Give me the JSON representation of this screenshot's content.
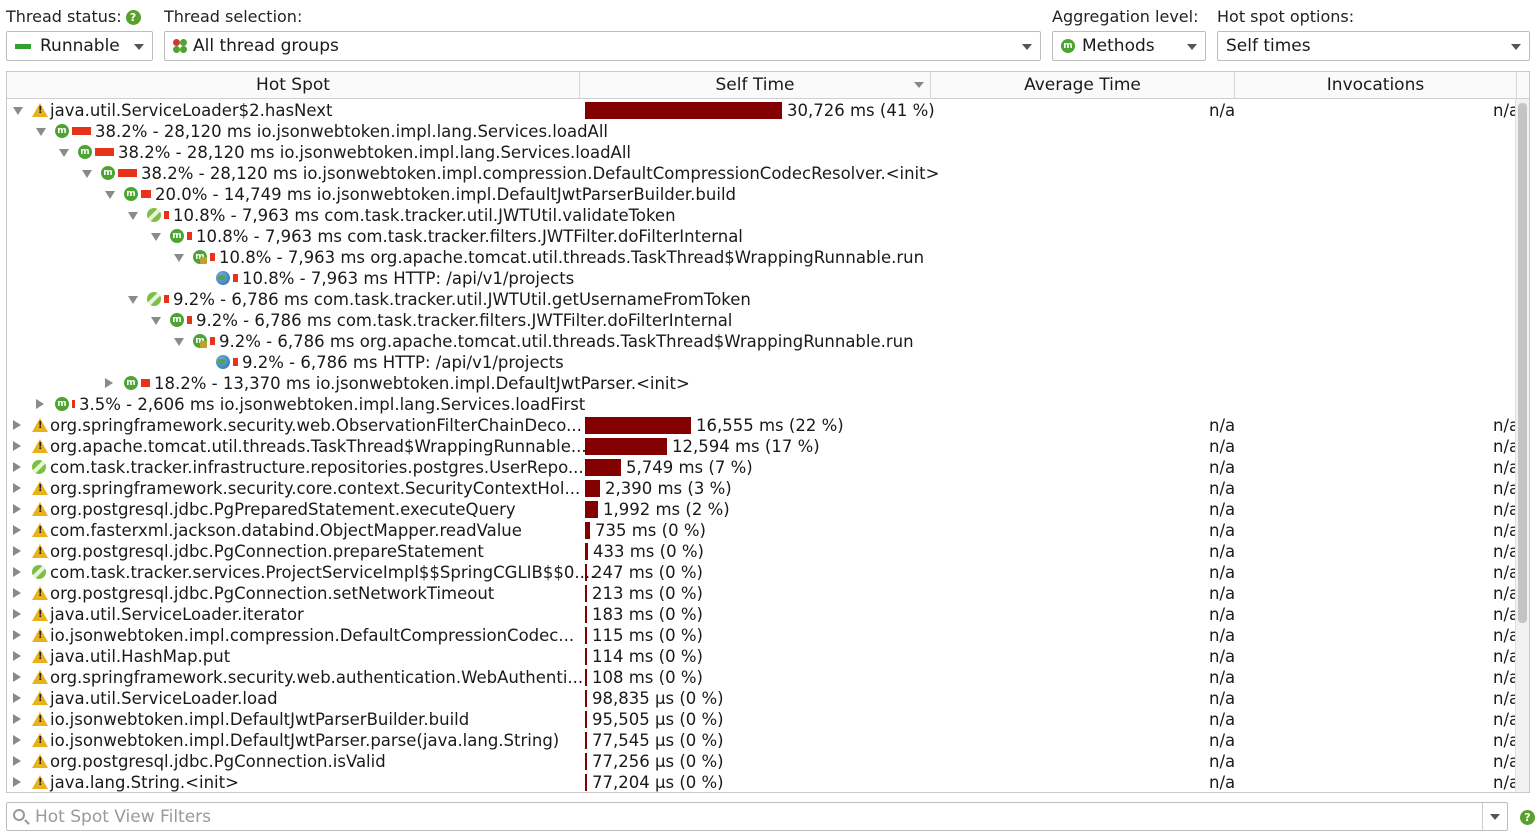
{
  "toolbar": {
    "thread_status_label": "Thread status:",
    "thread_status_value": "Runnable",
    "thread_selection_label": "Thread selection:",
    "thread_selection_value": "All thread groups",
    "aggregation_label": "Aggregation level:",
    "aggregation_value": "Methods",
    "hotspot_options_label": "Hot spot options:",
    "hotspot_options_value": "Self times",
    "help_glyph": "?",
    "method_glyph": "m"
  },
  "columns": {
    "hot_spot": "Hot Spot",
    "self_time": "Self Time",
    "average_time": "Average Time",
    "invocations": "Invocations"
  },
  "colors": {
    "self_time_bar": "#820000",
    "percent_bar": "#e8331c",
    "method_icon": "#4ea432",
    "warning_icon": "#e9b21a"
  },
  "rows": [
    {
      "depth": 0,
      "toggle": "open",
      "icon": "warning-icon",
      "text": "java.util.ServiceLoader$2.hasNext",
      "self_time": "30,726 ms (41 %)",
      "fraction": 0.41,
      "avg": "n/a",
      "inv": "n/a"
    },
    {
      "depth": 1,
      "toggle": "open",
      "icon": "method-icon",
      "pct": 0.382,
      "text": "38.2% - 28,120 ms io.jsonwebtoken.impl.lang.Services.loadAll"
    },
    {
      "depth": 2,
      "toggle": "open",
      "icon": "method-icon",
      "pct": 0.382,
      "text": "38.2% - 28,120 ms io.jsonwebtoken.impl.lang.Services.loadAll"
    },
    {
      "depth": 3,
      "toggle": "open",
      "icon": "method-icon",
      "pct": 0.382,
      "text": "38.2% - 28,120 ms io.jsonwebtoken.impl.compression.DefaultCompressionCodecResolver.<init>"
    },
    {
      "depth": 4,
      "toggle": "open",
      "icon": "method-icon",
      "pct": 0.2,
      "text": "20.0% - 14,749 ms io.jsonwebtoken.impl.DefaultJwtParserBuilder.build"
    },
    {
      "depth": 5,
      "toggle": "open",
      "icon": "spring-icon",
      "pct": 0.108,
      "text": "10.8% - 7,963 ms com.task.tracker.util.JWTUtil.validateToken"
    },
    {
      "depth": 6,
      "toggle": "open",
      "icon": "method-icon",
      "pct": 0.108,
      "text": "10.8% - 7,963 ms com.task.tracker.filters.JWTFilter.doFilterInternal"
    },
    {
      "depth": 7,
      "toggle": "open",
      "icon": "method-override-icon",
      "pct": 0.108,
      "text": "10.8% - 7,963 ms org.apache.tomcat.util.threads.TaskThread$WrappingRunnable.run"
    },
    {
      "depth": 8,
      "toggle": "none",
      "icon": "globe-icon",
      "pct": 0.108,
      "text": "10.8% - 7,963 ms HTTP: /api/v1/projects"
    },
    {
      "depth": 5,
      "toggle": "open",
      "icon": "spring-icon",
      "pct": 0.092,
      "text": "9.2% - 6,786 ms com.task.tracker.util.JWTUtil.getUsernameFromToken"
    },
    {
      "depth": 6,
      "toggle": "open",
      "icon": "method-icon",
      "pct": 0.092,
      "text": "9.2% - 6,786 ms com.task.tracker.filters.JWTFilter.doFilterInternal"
    },
    {
      "depth": 7,
      "toggle": "open",
      "icon": "method-override-icon",
      "pct": 0.092,
      "text": "9.2% - 6,786 ms org.apache.tomcat.util.threads.TaskThread$WrappingRunnable.run"
    },
    {
      "depth": 8,
      "toggle": "none",
      "icon": "globe-icon",
      "pct": 0.092,
      "text": "9.2% - 6,786 ms HTTP: /api/v1/projects"
    },
    {
      "depth": 4,
      "toggle": "closed",
      "icon": "method-icon",
      "pct": 0.182,
      "text": "18.2% - 13,370 ms io.jsonwebtoken.impl.DefaultJwtParser.<init>"
    },
    {
      "depth": 1,
      "toggle": "closed",
      "icon": "method-icon",
      "pct": 0.035,
      "text": "3.5% - 2,606 ms io.jsonwebtoken.impl.lang.Services.loadFirst"
    },
    {
      "depth": 0,
      "toggle": "closed",
      "icon": "warning-icon",
      "text": "org.springframework.security.web.ObservationFilterChainDeco...",
      "self_time": "16,555 ms (22 %)",
      "fraction": 0.22,
      "avg": "n/a",
      "inv": "n/a"
    },
    {
      "depth": 0,
      "toggle": "closed",
      "icon": "warning-icon",
      "text": "org.apache.tomcat.util.threads.TaskThread$WrappingRunnable....",
      "self_time": "12,594 ms (17 %)",
      "fraction": 0.17,
      "avg": "n/a",
      "inv": "n/a"
    },
    {
      "depth": 0,
      "toggle": "closed",
      "icon": "spring-icon",
      "text": "com.task.tracker.infrastructure.repositories.postgres.UserRepo...",
      "self_time": "5,749 ms (7 %)",
      "fraction": 0.075,
      "avg": "n/a",
      "inv": "n/a"
    },
    {
      "depth": 0,
      "toggle": "closed",
      "icon": "warning-icon",
      "text": "org.springframework.security.core.context.SecurityContextHol...",
      "self_time": "2,390 ms (3 %)",
      "fraction": 0.032,
      "avg": "n/a",
      "inv": "n/a"
    },
    {
      "depth": 0,
      "toggle": "closed",
      "icon": "warning-icon",
      "text": "org.postgresql.jdbc.PgPreparedStatement.executeQuery",
      "self_time": "1,992 ms (2 %)",
      "fraction": 0.027,
      "avg": "n/a",
      "inv": "n/a"
    },
    {
      "depth": 0,
      "toggle": "closed",
      "icon": "warning-icon",
      "text": "com.fasterxml.jackson.databind.ObjectMapper.readValue",
      "self_time": "735 ms (0 %)",
      "fraction": 0.01,
      "avg": "n/a",
      "inv": "n/a"
    },
    {
      "depth": 0,
      "toggle": "closed",
      "icon": "warning-icon",
      "text": "org.postgresql.jdbc.PgConnection.prepareStatement",
      "self_time": "433 ms (0 %)",
      "fraction": 0.006,
      "avg": "n/a",
      "inv": "n/a"
    },
    {
      "depth": 0,
      "toggle": "closed",
      "icon": "spring-icon",
      "text": "com.task.tracker.services.ProjectServiceImpl$$SpringCGLIB$$0....",
      "self_time": "247 ms (0 %)",
      "fraction": 0.004,
      "avg": "n/a",
      "inv": "n/a"
    },
    {
      "depth": 0,
      "toggle": "closed",
      "icon": "warning-icon",
      "text": "org.postgresql.jdbc.PgConnection.setNetworkTimeout",
      "self_time": "213 ms (0 %)",
      "fraction": 0.003,
      "avg": "n/a",
      "inv": "n/a"
    },
    {
      "depth": 0,
      "toggle": "closed",
      "icon": "warning-icon",
      "text": "java.util.ServiceLoader.iterator",
      "self_time": "183 ms (0 %)",
      "fraction": 0.003,
      "avg": "n/a",
      "inv": "n/a"
    },
    {
      "depth": 0,
      "toggle": "closed",
      "icon": "warning-icon",
      "text": "io.jsonwebtoken.impl.compression.DefaultCompressionCodec...",
      "self_time": "115 ms (0 %)",
      "fraction": 0.0015,
      "avg": "n/a",
      "inv": "n/a"
    },
    {
      "depth": 0,
      "toggle": "closed",
      "icon": "warning-icon",
      "text": "java.util.HashMap.put",
      "self_time": "114 ms (0 %)",
      "fraction": 0.0015,
      "avg": "n/a",
      "inv": "n/a"
    },
    {
      "depth": 0,
      "toggle": "closed",
      "icon": "warning-icon",
      "text": "org.springframework.security.web.authentication.WebAuthenti...",
      "self_time": "108 ms (0 %)",
      "fraction": 0.0014,
      "avg": "n/a",
      "inv": "n/a"
    },
    {
      "depth": 0,
      "toggle": "closed",
      "icon": "warning-icon",
      "text": "java.util.ServiceLoader.load",
      "self_time": "98,835 µs (0 %)",
      "fraction": 0.0013,
      "avg": "n/a",
      "inv": "n/a"
    },
    {
      "depth": 0,
      "toggle": "closed",
      "icon": "warning-icon",
      "text": "io.jsonwebtoken.impl.DefaultJwtParserBuilder.build",
      "self_time": "95,505 µs (0 %)",
      "fraction": 0.0013,
      "avg": "n/a",
      "inv": "n/a"
    },
    {
      "depth": 0,
      "toggle": "closed",
      "icon": "warning-icon",
      "text": "io.jsonwebtoken.impl.DefaultJwtParser.parse(java.lang.String)",
      "self_time": "77,545 µs (0 %)",
      "fraction": 0.001,
      "avg": "n/a",
      "inv": "n/a"
    },
    {
      "depth": 0,
      "toggle": "closed",
      "icon": "warning-icon",
      "text": "org.postgresql.jdbc.PgConnection.isValid",
      "self_time": "77,256 µs (0 %)",
      "fraction": 0.001,
      "avg": "n/a",
      "inv": "n/a"
    },
    {
      "depth": 0,
      "toggle": "closed",
      "icon": "warning-icon",
      "text": "java.lang.String.<init>",
      "self_time": "77,204 µs (0 %)",
      "fraction": 0.001,
      "avg": "n/a",
      "inv": "n/a"
    }
  ],
  "filter": {
    "placeholder": "Hot Spot View Filters"
  }
}
